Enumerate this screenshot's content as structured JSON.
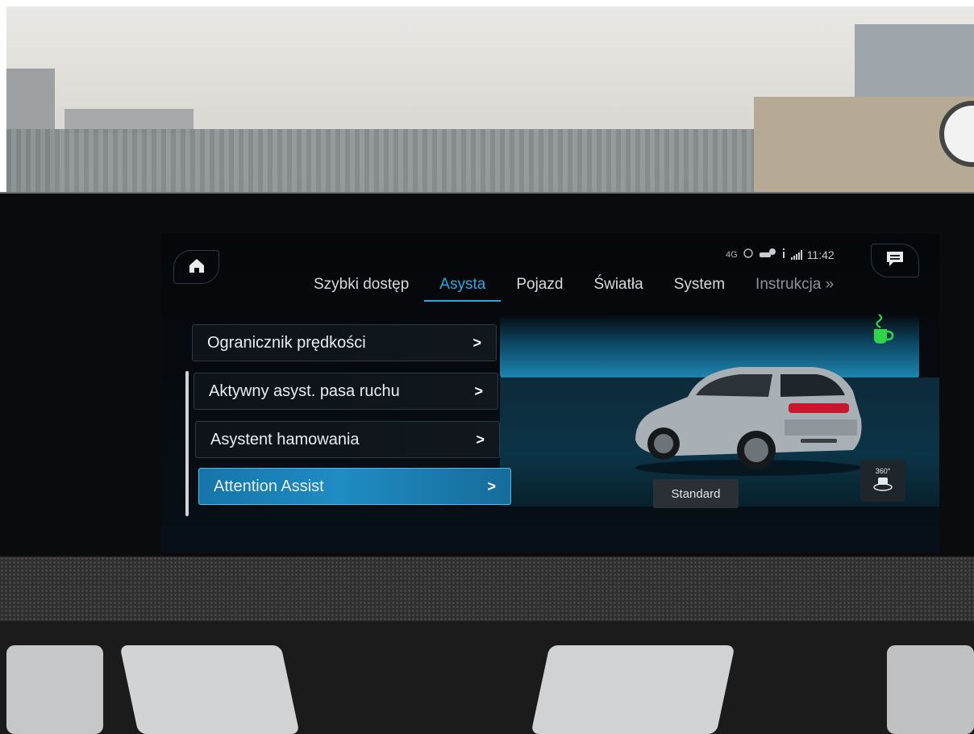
{
  "status_bar": {
    "time": "11:42",
    "network": "4G",
    "signal_label": "000"
  },
  "nav": {
    "tabs": [
      {
        "label": "Szybki dostęp"
      },
      {
        "label": "Asysta"
      },
      {
        "label": "Pojazd"
      },
      {
        "label": "Światła"
      },
      {
        "label": "System"
      },
      {
        "label": "Instrukcja"
      }
    ],
    "active_tab": "Asysta",
    "more_glyph": "»"
  },
  "menu": {
    "items": [
      {
        "label": "Ogranicznik prędkości",
        "chevron": ">"
      },
      {
        "label": "Aktywny asyst. pasa ruchu",
        "chevron": ">"
      },
      {
        "label": "Asystent hamowania",
        "chevron": ">"
      },
      {
        "label": "Attention Assist",
        "chevron": ">",
        "selected": true
      }
    ]
  },
  "vehicle_panel": {
    "standard_button": "Standard",
    "camera_button": "360°"
  },
  "colors": {
    "accent": "#27a8e0",
    "selected_item": "#1f8cc3",
    "coffee_icon": "#2fd44a"
  },
  "icons": [
    "home-icon",
    "message-icon",
    "coffee-icon",
    "camera-360-icon",
    "car-illustration"
  ]
}
